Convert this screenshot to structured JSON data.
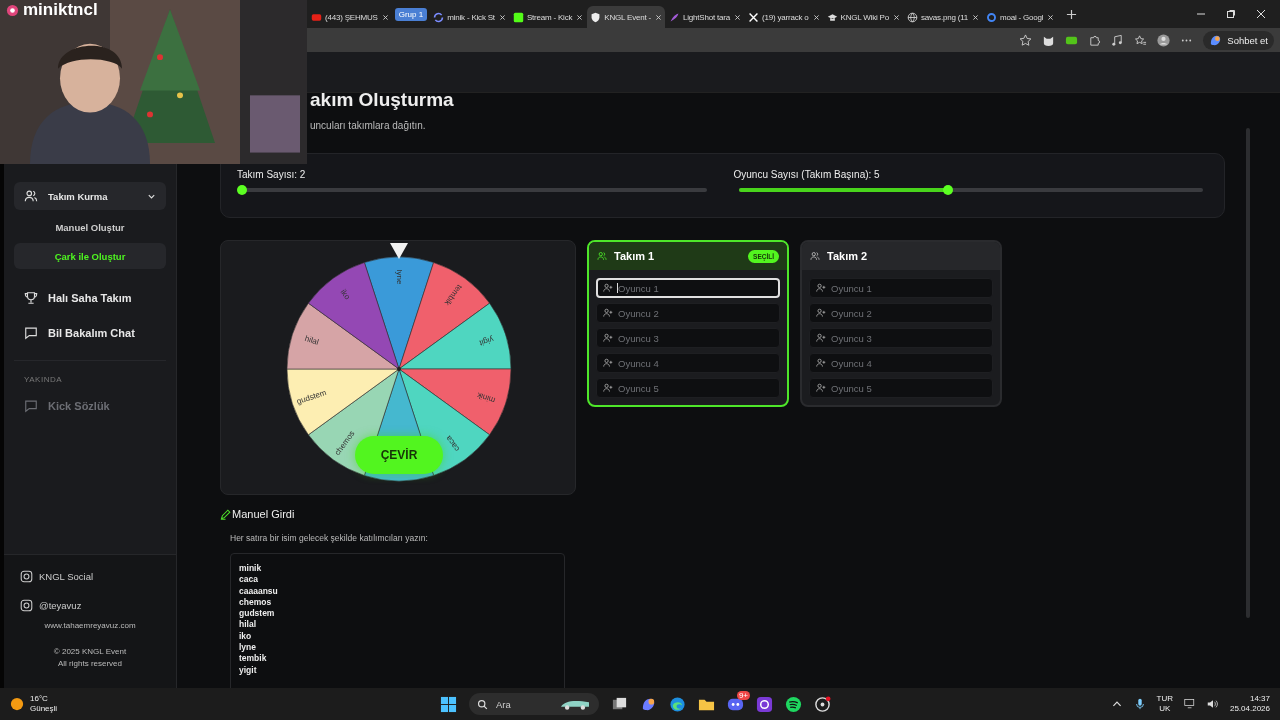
{
  "stream_overlay": {
    "channel": "miniktncl"
  },
  "browser": {
    "tabs": [
      {
        "kind": "video",
        "title": "(443) ŞEHMUS",
        "selected": false
      },
      {
        "kind": "group",
        "title": "Grup 1",
        "selected": false
      },
      {
        "kind": "spinner",
        "title": "minik - Kick St",
        "selected": false
      },
      {
        "kind": "kick",
        "title": "Stream - Kick",
        "selected": false
      },
      {
        "kind": "shield",
        "title": "KNGL Event -",
        "selected": true
      },
      {
        "kind": "feather",
        "title": "LightShot tara",
        "selected": false
      },
      {
        "kind": "x",
        "title": "(19) yarrack o",
        "selected": false
      },
      {
        "kind": "hat",
        "title": "KNGL Wiki Po",
        "selected": false
      },
      {
        "kind": "globe",
        "title": "savas.png (11",
        "selected": false
      },
      {
        "kind": "google",
        "title": "moai - Googl",
        "selected": false
      }
    ],
    "chat_button": "Sohbet et"
  },
  "sidebar": {
    "items": [
      {
        "label": "Takım Kurma",
        "expanded": true,
        "children": [
          {
            "label": "Manuel Oluştur",
            "selected": false
          },
          {
            "label": "Çark ile Oluştur",
            "selected": true
          }
        ]
      },
      {
        "label": "Halı Saha Takım"
      },
      {
        "label": "Bil Bakalım Chat"
      }
    ],
    "section": "YAKINDA",
    "soon_items": [
      {
        "label": "Kick Sözlük",
        "disabled": true
      }
    ],
    "socials": [
      {
        "label": "KNGL Social"
      },
      {
        "label": "@teyavuz"
      }
    ],
    "website": "www.tahaemreyavuz.com",
    "copyright": "© 2025 KNGL Event",
    "rights": "All rights reserved"
  },
  "page": {
    "title": "akım Oluşturma",
    "subtitle": "uncuları takımlara dağıtın."
  },
  "sliders": [
    {
      "label": "Takım Sayısı: 2",
      "level": 0
    },
    {
      "label": "Oyuncu Sayısı (Takım Başına): 5",
      "level": 0.45
    }
  ],
  "wheel": {
    "segments": [
      {
        "label": "lyne",
        "color": "#3a9ad9"
      },
      {
        "label": "tembik",
        "color": "#f0606c"
      },
      {
        "label": "yigit",
        "color": "#4fd6c0"
      },
      {
        "label": "minik",
        "color": "#f0606c"
      },
      {
        "label": "caca",
        "color": "#4fd6c0"
      },
      {
        "color": "#45b8cf"
      },
      {
        "label": "chemos",
        "color": "#98d6b4"
      },
      {
        "label": "gudstem",
        "color": "#fdeeb2"
      },
      {
        "label": "hilal",
        "color": "#d6a4a6"
      },
      {
        "label": "iko",
        "color": "#9448b4"
      }
    ],
    "spin_button": "ÇEVİR"
  },
  "teams": [
    {
      "name": "Takım 1",
      "selected": true,
      "badge": "SEÇİLİ",
      "players": [
        {
          "placeholder": "Oyuncu 1",
          "focused": true
        },
        {
          "placeholder": "Oyuncu 2",
          "focused": false
        },
        {
          "placeholder": "Oyuncu 3",
          "focused": false
        },
        {
          "placeholder": "Oyuncu 4",
          "focused": false
        },
        {
          "placeholder": "Oyuncu 5",
          "focused": false
        }
      ]
    },
    {
      "name": "Takım 2",
      "selected": false,
      "players": [
        {
          "placeholder": "Oyuncu 1",
          "focused": false
        },
        {
          "placeholder": "Oyuncu 2",
          "focused": false
        },
        {
          "placeholder": "Oyuncu 3",
          "focused": false
        },
        {
          "placeholder": "Oyuncu 4",
          "focused": false
        },
        {
          "placeholder": "Oyuncu 5",
          "focused": false
        }
      ]
    }
  ],
  "manual": {
    "title": "Manuel Girdi",
    "hint": "Her satıra bir isim gelecek şekilde katılımcıları yazın:",
    "lines": [
      "minik",
      "caca",
      "caaaansu",
      "chemos",
      "gudstem",
      "hilal",
      "iko",
      "lyne",
      "tembik",
      "yigit"
    ]
  },
  "taskbar": {
    "temperature": "16°C",
    "weather": "Güneşli",
    "search_placeholder": "Ara",
    "discord_badge": "9+",
    "language": "TUR",
    "layout": "UK",
    "time": "14:37",
    "date": "25.04.2026"
  }
}
